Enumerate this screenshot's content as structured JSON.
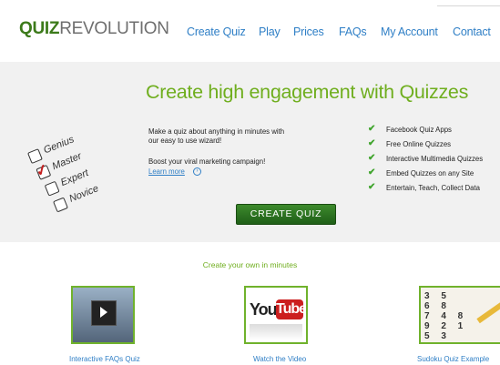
{
  "brand": {
    "logo_bold": "QUIZ",
    "logo_light": "REVOLUTION"
  },
  "nav": {
    "items": [
      {
        "label": "Create Quiz"
      },
      {
        "label": "Play"
      },
      {
        "label": "Prices"
      },
      {
        "label": "FAQs"
      },
      {
        "label": "My Account"
      },
      {
        "label": "Contact"
      }
    ]
  },
  "hero": {
    "headline": "Create high engagement with Quizzes",
    "levels": [
      "Genius",
      "Master",
      "Expert",
      "Novice"
    ],
    "checked_level": "Master",
    "intro_line1": "Make a quiz about anything in minutes with",
    "intro_line2": "our easy to use wizard!",
    "boost": "Boost your viral marketing campaign!",
    "learn_more": "Learn more",
    "features": [
      "Facebook Quiz Apps",
      "Free Online Quizzes",
      "Interactive Multimedia Quizzes",
      "Embed Quizzes on any Site",
      "Entertain, Teach, Collect Data"
    ],
    "cta": "CREATE QUIZ"
  },
  "examples": {
    "subtitle": "Create your own in minutes",
    "items": [
      {
        "caption": "Interactive FAQs Quiz",
        "icon": "video-player-icon"
      },
      {
        "caption": "Watch the Video",
        "icon": "youtube-logo-icon",
        "logo_you": "You",
        "logo_tube": "Tube"
      },
      {
        "caption": "Sudoku Quiz Example",
        "icon": "sudoku-icon",
        "grid": "3 5\n6 8\n7 4 8\n9 2 1\n5 3"
      }
    ]
  },
  "colors": {
    "accent_green": "#6fae1e",
    "link_blue": "#2f7fc6",
    "logo_green": "#3c7a1a",
    "cta_green": "#2f7a22"
  }
}
